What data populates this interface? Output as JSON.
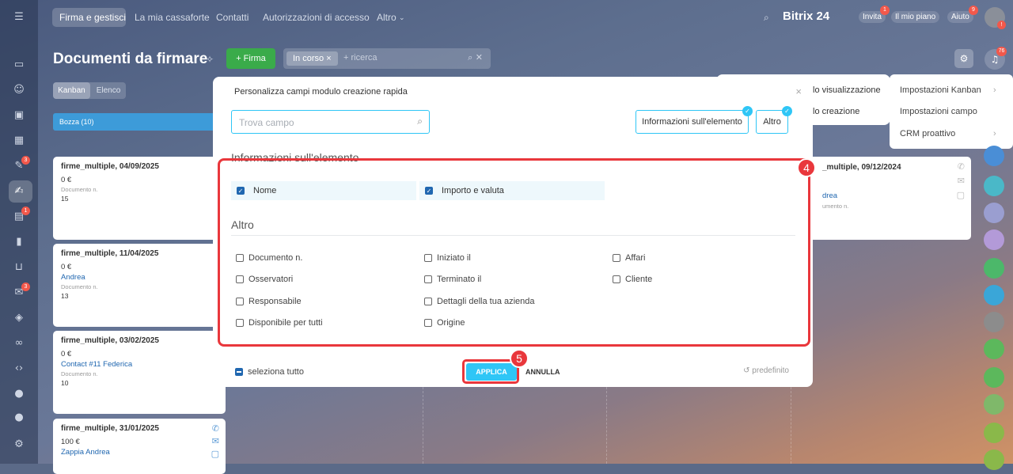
{
  "topnav": {
    "items": [
      "Firma e gestisci",
      "La mia cassaforte",
      "Contatti",
      "Autorizzazioni di accesso",
      "Altro"
    ],
    "brand": "Bitrix 24",
    "invite": "Invita",
    "invite_badge": "1",
    "plan": "Il mio piano",
    "help": "Aiuto",
    "help_badge": "9",
    "avatar_badge": "!"
  },
  "leftbar": {
    "badges": [
      "3",
      "1",
      "3"
    ]
  },
  "page": {
    "title": "Documenti da firmare",
    "add_label": "+ Firma",
    "filter_chip": "In corso",
    "filter_placeholder": "+ ricerca",
    "bell_badge": "76",
    "view_kanban": "Kanban",
    "view_list": "Elenco"
  },
  "column": {
    "name": "Bozza",
    "count": "(10)"
  },
  "cards": [
    {
      "title": "firme_multiple, 04/09/2025",
      "amount": "0 €",
      "contact": "",
      "doc_label": "Documento n.",
      "doc_number": "15"
    },
    {
      "title": "firme_multiple, 11/04/2025",
      "amount": "0 €",
      "contact": "Andrea",
      "doc_label": "Documento n.",
      "doc_number": "13"
    },
    {
      "title": "firme_multiple, 03/02/2025",
      "amount": "0 €",
      "contact": "Contact #11 Federica",
      "doc_label": "Documento n.",
      "doc_number": "10"
    },
    {
      "title": "firme_multiple, 31/01/2025",
      "amount": "100 €",
      "contact": "Zappia Andrea",
      "doc_label": "",
      "doc_number": ""
    }
  ],
  "right_card": {
    "title": "_multiple, 09/12/2024",
    "contact": "drea",
    "doc_label": "umento n."
  },
  "settings_menu": {
    "items": [
      "lo visualizzazione",
      "lo creazione"
    ],
    "submenu": [
      "Impostazioni Kanban",
      "Impostazioni campo",
      "CRM proattivo"
    ]
  },
  "modal": {
    "title": "Personalizza campi modulo creazione rapida",
    "search_placeholder": "Trova campo",
    "seg_info": "Informazioni sull'elemento",
    "seg_other": "Altro",
    "section_info": "Informazioni sull'elemento",
    "section_other": "Altro",
    "checked": [
      "Nome",
      "Importo e valuta"
    ],
    "other_fields": {
      "col1": [
        "Documento n.",
        "Osservatori",
        "Responsabile",
        "Disponibile per tutti"
      ],
      "col2": [
        "Iniziato il",
        "Terminato il",
        "Dettagli della tua azienda",
        "Origine"
      ],
      "col3": [
        "Affari",
        "Cliente"
      ]
    },
    "select_all": "seleziona tutto",
    "apply": "APPLICA",
    "cancel": "ANNULLA",
    "default": "predefinito"
  },
  "annotations": {
    "step4": "4",
    "step5": "5"
  },
  "colors": {
    "accent": "#2fc6f6",
    "highlight": "#e9373c",
    "green": "#3aab4a",
    "column_blue": "#3d9bd9"
  }
}
